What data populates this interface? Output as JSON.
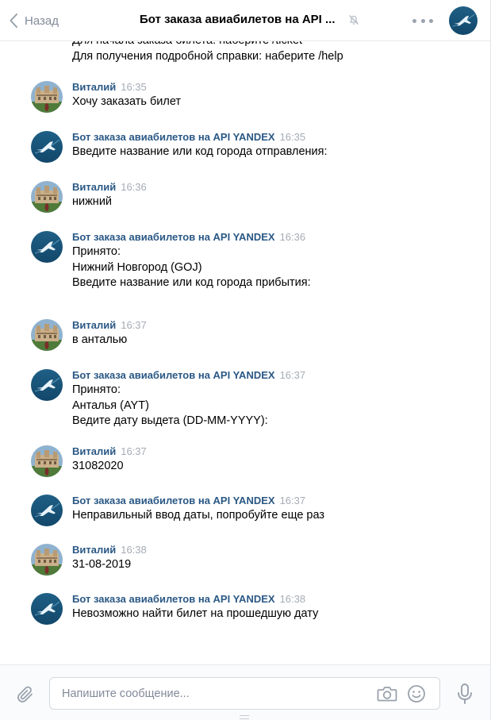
{
  "header": {
    "back_label": "Назад",
    "title": "Бот заказа авиабилетов на API ...",
    "icons": {
      "back": "chevron-left-icon",
      "mute": "muted-bell-icon",
      "more": "more-dots-icon"
    }
  },
  "feed": {
    "cut_line_1": "Для начала заказа билета: наберите /ticket",
    "cut_line_2": "Для получения подробной справки: наберите /help",
    "messages": [
      {
        "author": "Виталий",
        "time": "16:35",
        "lines": [
          "Хочу заказать билет"
        ]
      },
      {
        "author": "Бот заказа авиабилетов на API YANDEX",
        "time": "16:35",
        "lines": [
          "Введите название или код города отправления:"
        ]
      },
      {
        "author": "Виталий",
        "time": "16:36",
        "lines": [
          "нижний"
        ]
      },
      {
        "author": "Бот заказа авиабилетов на API YANDEX",
        "time": "16:36",
        "lines": [
          "Принято:",
          "Нижний Новгород (GOJ)",
          "Введите название или код города прибытия:"
        ]
      },
      {
        "author": "Виталий",
        "time": "16:37",
        "lines": [
          "в анталью"
        ]
      },
      {
        "author": "Бот заказа авиабилетов на API YANDEX",
        "time": "16:37",
        "lines": [
          "Принято:",
          "Анталья (AYT)",
          "Ведите дату выдета (DD-MM-YYYY):"
        ]
      },
      {
        "author": "Виталий",
        "time": "16:37",
        "lines": [
          "31082020"
        ]
      },
      {
        "author": "Бот заказа авиабилетов на API YANDEX",
        "time": "16:37",
        "lines": [
          "Неправильный ввод даты, попробуйте еще раз"
        ]
      },
      {
        "author": "Виталий",
        "time": "16:38",
        "lines": [
          "31-08-2019"
        ]
      },
      {
        "author": "Бот заказа авиабилетов на API YANDEX",
        "time": "16:38",
        "lines": [
          "Невозможно найти билет на прошедшую дату"
        ]
      }
    ]
  },
  "composer": {
    "placeholder": "Напишите сообщение...",
    "icons": {
      "attach": "paperclip-icon",
      "camera": "camera-icon",
      "emoji": "smile-icon",
      "voice": "microphone-icon"
    }
  },
  "colors": {
    "author": "#2a5885",
    "muted": "#828a99",
    "time": "#a5acb5",
    "border": "#e7e8ec"
  }
}
